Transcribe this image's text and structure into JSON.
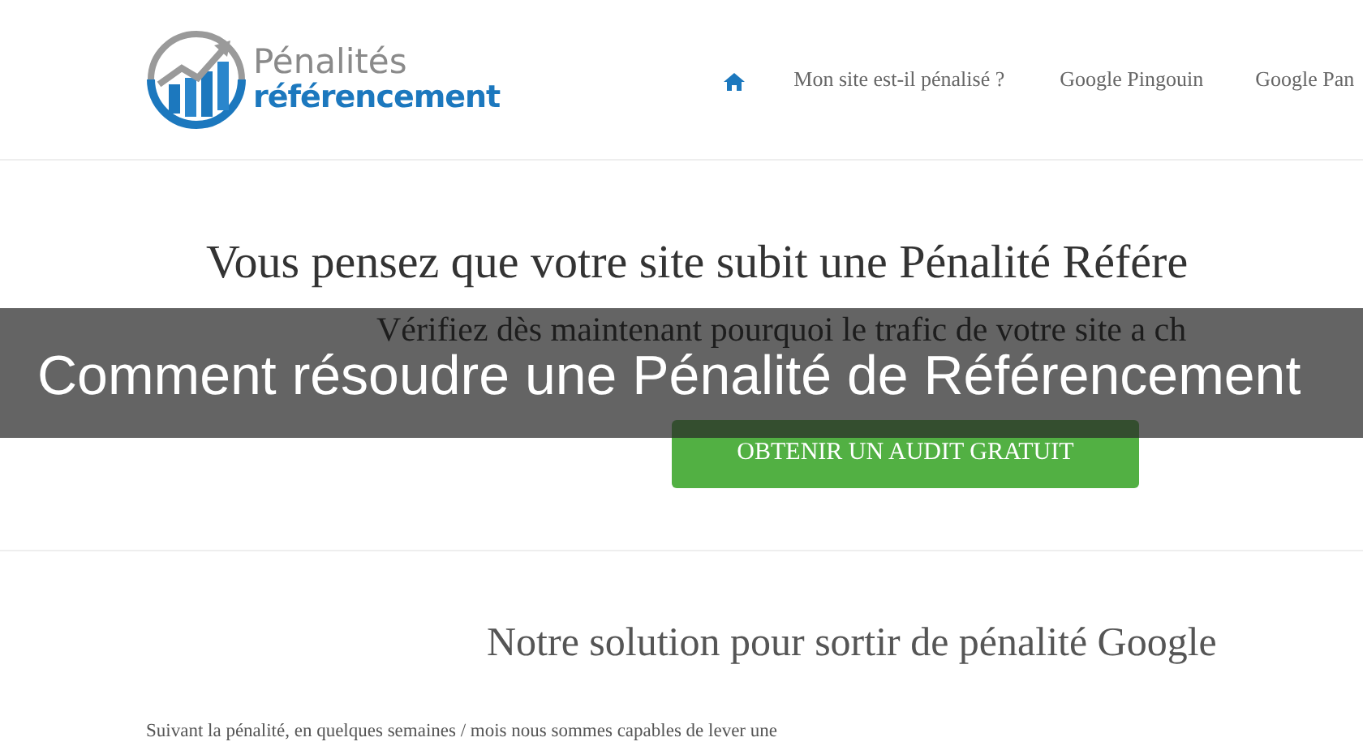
{
  "logo": {
    "line_1": "Pénalités",
    "line_2": "référencement"
  },
  "nav": [
    {
      "kind": "home"
    },
    {
      "kind": "link",
      "label": "Mon site est-il pénalisé ?"
    },
    {
      "kind": "link",
      "label": "Google Pingouin"
    },
    {
      "kind": "link",
      "label": "Google Pan"
    }
  ],
  "hero": {
    "heading": "Vous pensez que votre site subit une Pénalité Référe",
    "subtitle": "Vérifiez dès maintenant pourquoi le trafic de votre site a ch",
    "button": "OBTENIR UN AUDIT GRATUIT"
  },
  "section": {
    "heading": "Notre solution pour sortir de pénalité Google",
    "paragraph": "Suivant la pénalité, en quelques semaines / mois nous sommes capables de lever une"
  },
  "overlay": {
    "caption": "Comment résoudre une Pénalité de Référencement"
  }
}
